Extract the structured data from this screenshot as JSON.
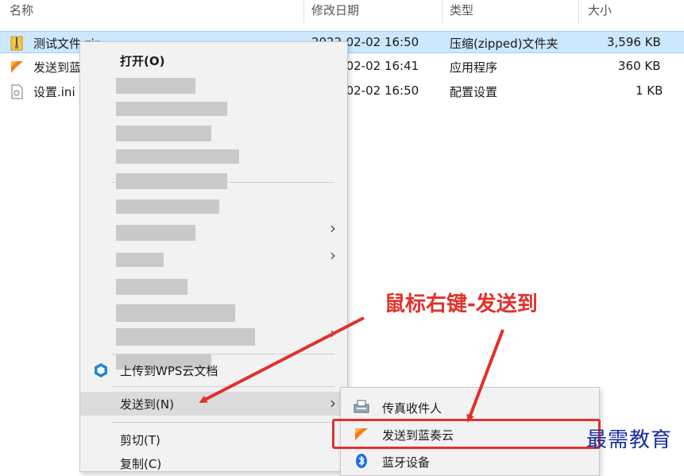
{
  "header": {
    "col_name": "名称",
    "col_date": "修改日期",
    "col_type": "类型",
    "col_size": "大小"
  },
  "files": [
    {
      "name": "测试文件.zip",
      "date": "2022-02-02 16:50",
      "type": "压缩(zipped)文件夹",
      "size": "3,596 KB",
      "icon": "zip-folder-icon",
      "selected": true
    },
    {
      "name": "发送到蓝奏云",
      "date": "2022-02-02 16:41",
      "type": "应用程序",
      "size": "360 KB",
      "icon": "lanzou-app-icon"
    },
    {
      "name": "设置.ini",
      "date": "2022-02-02 16:50",
      "type": "配置设置",
      "size": "1 KB",
      "icon": "ini-file-icon"
    }
  ],
  "context_menu": {
    "open": "打开(O)",
    "upload_wps": "上传到WPS云文档",
    "send_to": "发送到(N)",
    "cut": "剪切(T)",
    "copy": "复制(C)"
  },
  "submenu": {
    "fax": "传真收件人",
    "lanzou": "发送到蓝奏云",
    "bluetooth": "蓝牙设备"
  },
  "annotation": "鼠标右键-发送到",
  "watermark": "最需教育",
  "colors": {
    "accent_red": "#e0322b",
    "selection": "#cce8ff",
    "watermark_blue": "#1a2da0"
  }
}
